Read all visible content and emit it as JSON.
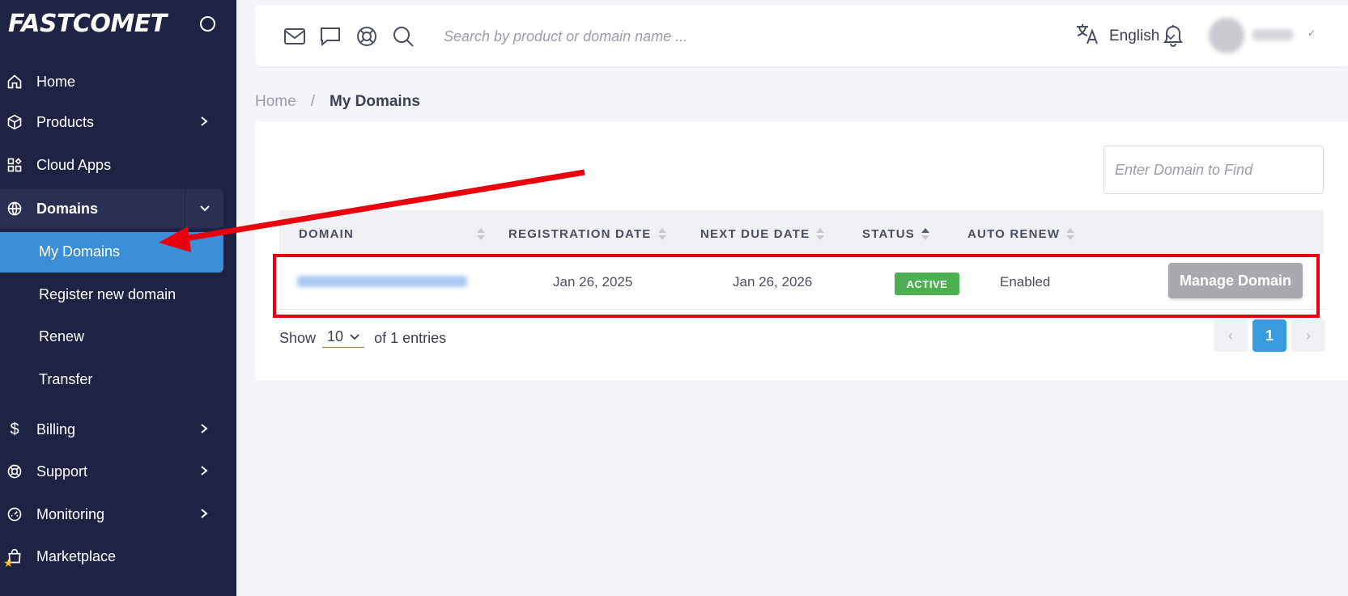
{
  "app": {
    "logo": "FASTCOMET"
  },
  "sidebar": {
    "items": [
      {
        "label": "Home",
        "icon": "home-icon"
      },
      {
        "label": "Products",
        "icon": "box-icon"
      },
      {
        "label": "Cloud Apps",
        "icon": "apps-icon"
      },
      {
        "label": "Domains",
        "icon": "globe-icon"
      },
      {
        "label": "Billing",
        "icon": "dollar-icon"
      },
      {
        "label": "Support",
        "icon": "lifebuoy-icon"
      },
      {
        "label": "Monitoring",
        "icon": "gauge-icon"
      },
      {
        "label": "Marketplace",
        "icon": "shopping-bag-icon"
      }
    ],
    "domains_sub": [
      "My Domains",
      "Register new domain",
      "Renew",
      "Transfer"
    ]
  },
  "topbar": {
    "search_placeholder": "Search by product or domain name ...",
    "language": "English"
  },
  "breadcrumb": {
    "home": "Home",
    "separator": "/",
    "current": "My Domains"
  },
  "domains_table": {
    "find_placeholder": "Enter Domain to Find",
    "columns": [
      "DOMAIN",
      "REGISTRATION DATE",
      "NEXT DUE DATE",
      "STATUS",
      "AUTO RENEW"
    ],
    "rows": [
      {
        "registration_date": "Jan 26, 2025",
        "next_due_date": "Jan 26, 2026",
        "status": "ACTIVE",
        "auto_renew": "Enabled",
        "action": "Manage Domain"
      }
    ],
    "show_label": "Show",
    "page_size": "10",
    "entries_label": "of 1 entries",
    "current_page": "1",
    "prev": "‹",
    "next": "›"
  },
  "colors": {
    "sidebar_bg": "#1f2343",
    "accent": "#3a8fd8",
    "status_active": "#4caf50",
    "annotation": "#e8000d"
  }
}
